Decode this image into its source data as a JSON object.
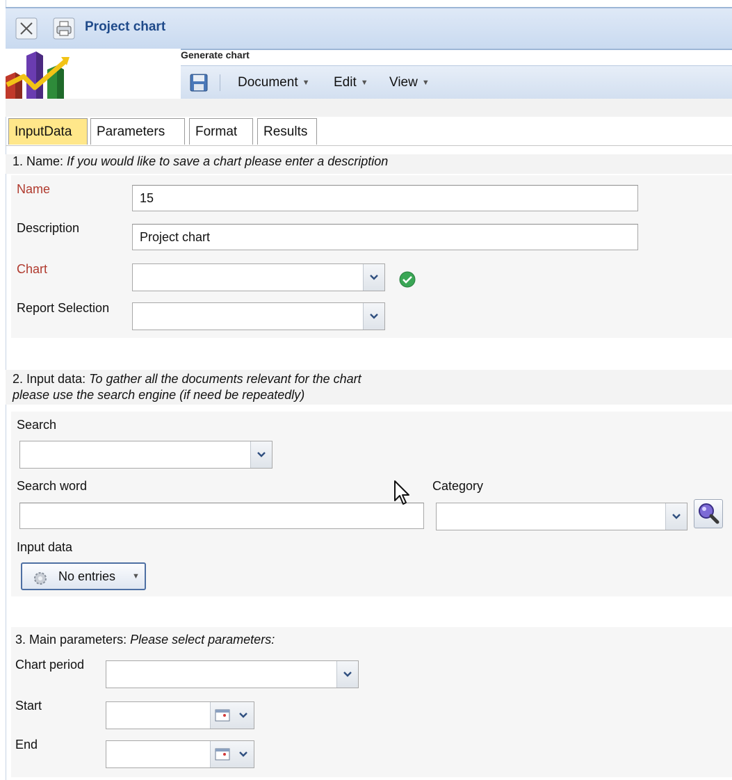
{
  "window": {
    "title": "Project chart"
  },
  "app": {
    "heading": "Generate chart"
  },
  "menus": [
    {
      "label": "Document"
    },
    {
      "label": "Edit"
    },
    {
      "label": "View"
    }
  ],
  "tabs": [
    {
      "label": "InputData",
      "active": true
    },
    {
      "label": "Parameters",
      "active": false
    },
    {
      "label": "Format",
      "active": false
    },
    {
      "label": "Results",
      "active": false
    }
  ],
  "section1": {
    "number": "1. Name:",
    "hint": "If you would like to save a chart please enter a description",
    "name_label": "Name",
    "name_value": "15",
    "description_label": "Description",
    "description_value": "Project chart",
    "chart_label": "Chart",
    "chart_value": "",
    "report_label": "Report Selection",
    "report_value": ""
  },
  "section2": {
    "number": "2. Input data:",
    "hint_line1": "To gather all the documents relevant for the chart",
    "hint_line2": "please use the search engine (if need be repeatedly)",
    "search_label": "Search",
    "search_value": "",
    "search_word_label": "Search word",
    "search_word_value": "",
    "category_label": "Category",
    "category_value": "",
    "input_data_label": "Input data",
    "input_data_button": "No entries"
  },
  "section3": {
    "number": "3. Main parameters:",
    "hint": "Please select parameters:",
    "period_label": "Chart period",
    "period_value": "",
    "start_label": "Start",
    "start_value": "",
    "end_label": "End",
    "end_value": ""
  },
  "colors": {
    "required_label": "#b03a2e",
    "title_text": "#1f4a8a",
    "active_tab": "#ffe78a",
    "titlebar": "#c9daf0"
  },
  "icons": [
    "close-icon",
    "print-icon",
    "chart-logo-icon",
    "save-icon",
    "check-ok-icon",
    "magnifier-icon",
    "gear-icon",
    "calendar-icon",
    "chevron-down-icon",
    "mouse-cursor-icon"
  ]
}
